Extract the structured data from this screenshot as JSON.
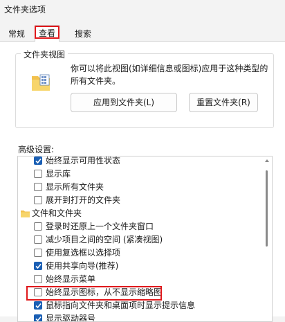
{
  "window": {
    "title": "文件夹选项"
  },
  "tabs": [
    {
      "label": "常规"
    },
    {
      "label": "查看"
    },
    {
      "label": "搜索"
    }
  ],
  "folder_views": {
    "legend": "文件夹视图",
    "description": "你可以将此视图(如详细信息或图标)应用于这种类型的所有文件夹。",
    "apply_button": "应用到文件夹(L)",
    "reset_button": "重置文件夹(R)"
  },
  "advanced": {
    "label": "高级设置:",
    "items": [
      {
        "type": "checkbox",
        "label": "始终显示可用性状态",
        "checked": true
      },
      {
        "type": "checkbox",
        "label": "显示库",
        "checked": false
      },
      {
        "type": "checkbox",
        "label": "显示所有文件夹",
        "checked": false
      },
      {
        "type": "checkbox",
        "label": "展开到打开的文件夹",
        "checked": false
      },
      {
        "type": "folder",
        "label": "文件和文件夹"
      },
      {
        "type": "checkbox",
        "label": "登录时还原上一个文件夹窗口",
        "checked": false
      },
      {
        "type": "checkbox",
        "label": "减少项目之间的空间 (紧凑视图)",
        "checked": false
      },
      {
        "type": "checkbox",
        "label": "使用复选框以选择项",
        "checked": false
      },
      {
        "type": "checkbox",
        "label": "使用共享向导(推荐)",
        "checked": true
      },
      {
        "type": "checkbox",
        "label": "始终显示菜单",
        "checked": false
      },
      {
        "type": "checkbox",
        "label": "始终显示图标，从不显示缩略图",
        "checked": false
      },
      {
        "type": "checkbox",
        "label": "鼠标指向文件夹和桌面项时显示提示信息",
        "checked": true
      },
      {
        "type": "checkbox",
        "label": "显示驱动器号",
        "checked": true
      }
    ]
  },
  "colors": {
    "accent": "#1a5fb4",
    "highlight": "#e0181b"
  }
}
